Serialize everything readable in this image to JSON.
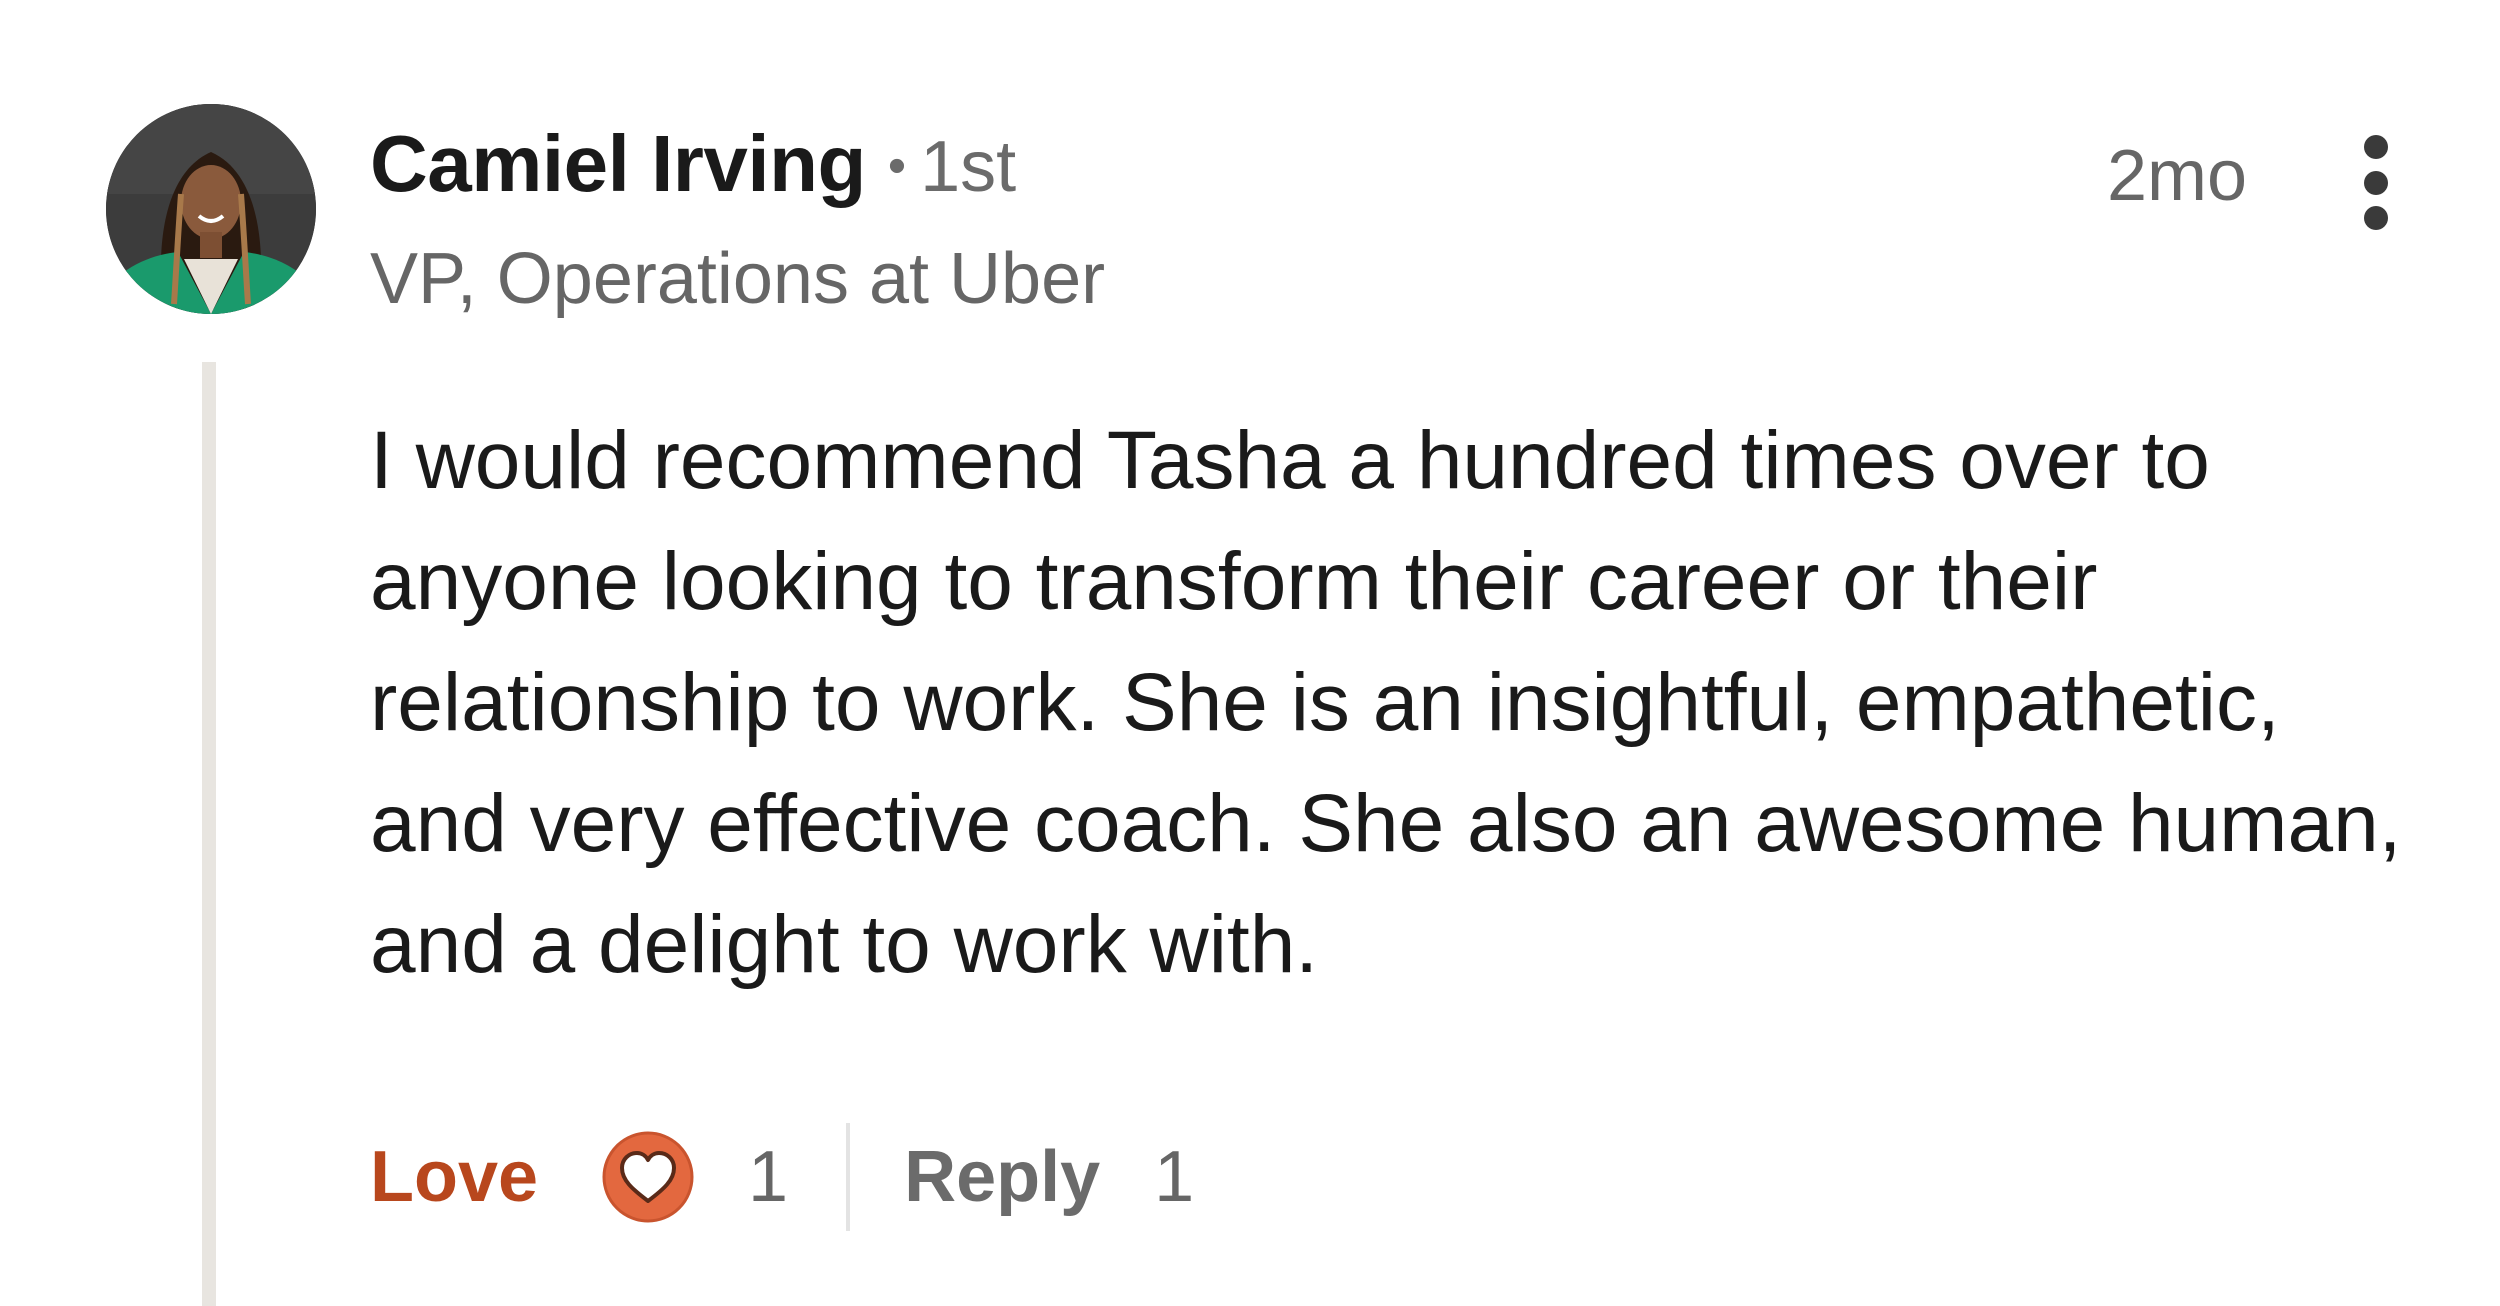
{
  "author": {
    "name": "Camiel Irving",
    "separator": "•",
    "degree": "1st",
    "headline": "VP, Operations at Uber",
    "avatar": "profile-photo"
  },
  "comment": {
    "time": "2mo",
    "text": "I would recommend Tasha a hundred times over to anyone looking to transform their career or their relationship to work. She is an insightful, empathetic, and very effective coach. She also an awesome human, and a delight to work with."
  },
  "actions": {
    "reaction_label": "Love",
    "reaction_icon": "heart-reaction-icon",
    "reaction_count": "1",
    "reply_label": "Reply",
    "reply_count": "1"
  },
  "colors": {
    "love": "#b8471d",
    "heart_badge": "#e3683f",
    "thread_line": "#e8e5e0"
  },
  "icons": {
    "more": "three-dots-vertical-icon"
  }
}
